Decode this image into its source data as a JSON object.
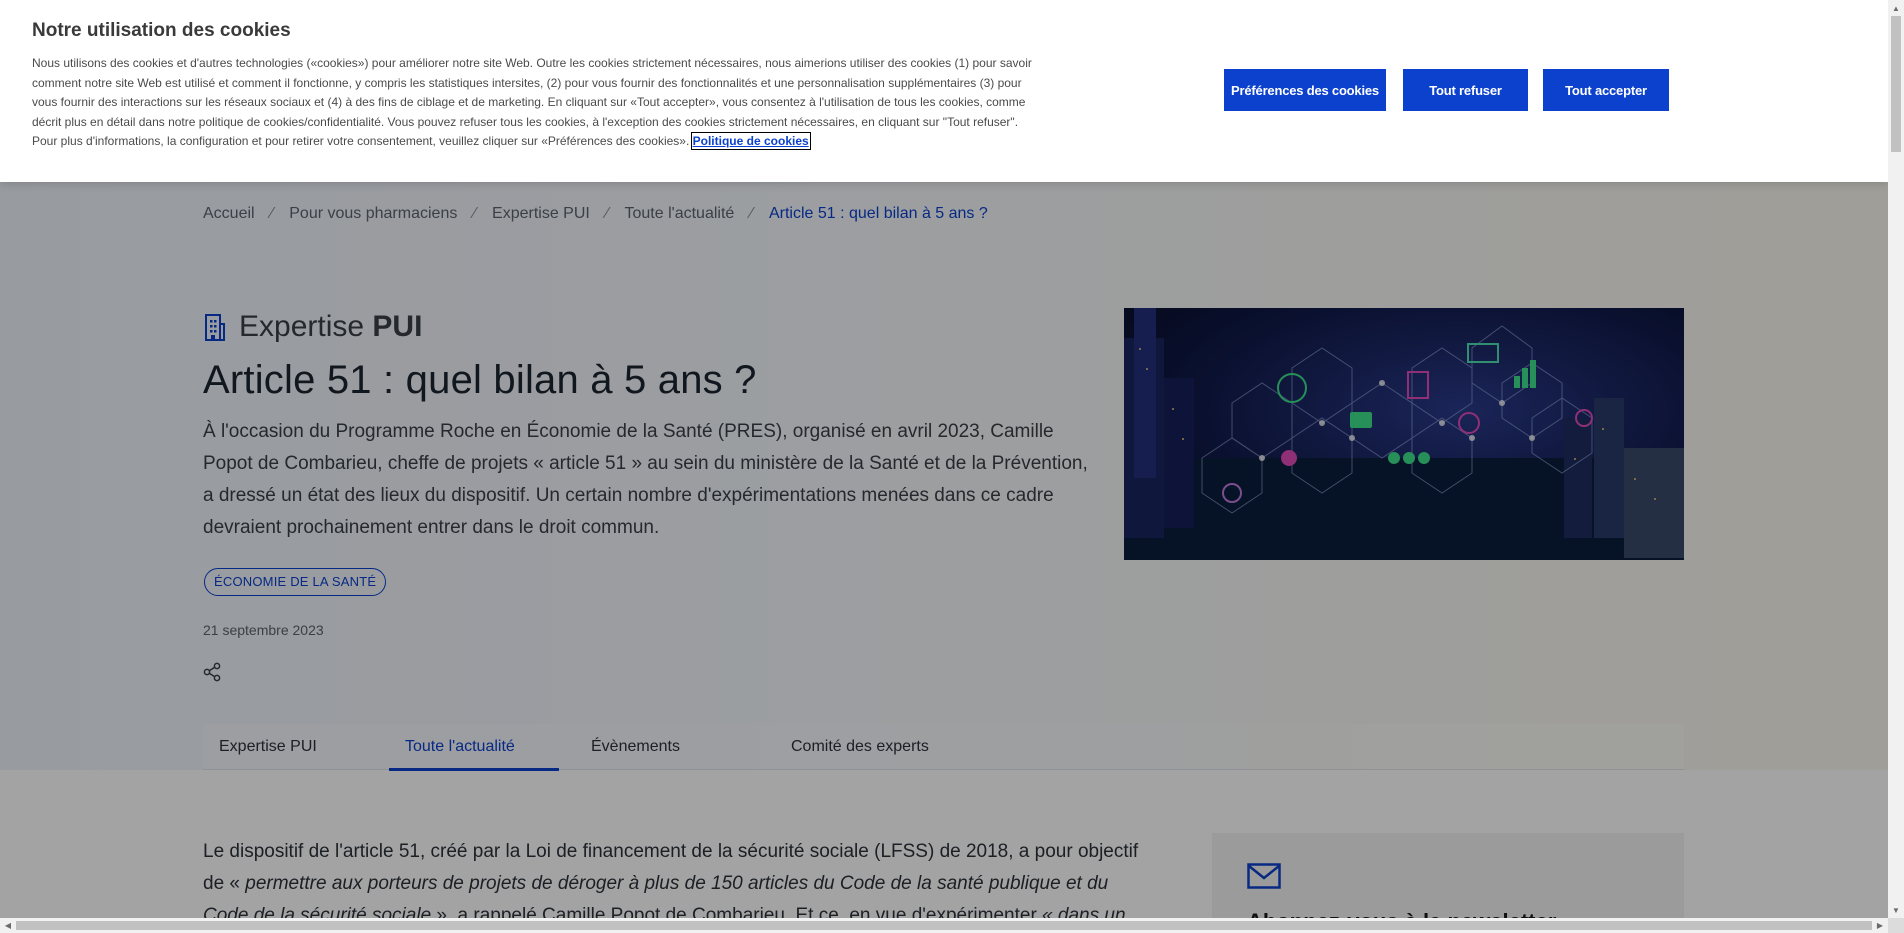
{
  "cookie_banner": {
    "title": "Notre utilisation des cookies",
    "text": "Nous utilisons des cookies et d'autres technologies («cookies») pour améliorer notre site Web. Outre les cookies strictement nécessaires, nous aimerions utiliser des cookies (1) pour savoir comment notre site Web est utilisé et comment il fonctionne, y compris les statistiques intersites, (2) pour vous fournir des fonctionnalités et une personnalisation supplémentaires (3) pour vous fournir des interactions sur les réseaux sociaux et (4) à des fins de ciblage et de marketing. En cliquant sur «Tout accepter», vous consentez à l'utilisation de tous les cookies, comme décrit plus en détail dans notre politique de cookies/confidentialité. Vous pouvez refuser tous les cookies, à l'exception des cookies strictement nécessaires, en cliquant sur \"Tout refuser\". Pour plus d'informations, la configuration et pour retirer votre consentement, veuillez cliquer sur «Préférences des cookies».",
    "policy_link": "Politique de cookies",
    "btn_preferences": "Préférences des cookies",
    "btn_refuse": "Tout refuser",
    "btn_accept": "Tout accepter"
  },
  "breadcrumb": {
    "items": [
      "Accueil",
      "Pour vous pharmaciens",
      "Expertise PUI",
      "Toute l'actualité"
    ],
    "separator": "⁄",
    "current": "Article 51 : quel bilan à 5 ans ?"
  },
  "section": {
    "prefix": "Expertise",
    "name": "PUI"
  },
  "article": {
    "title": "Article 51 : quel bilan à 5 ans ?",
    "lead": "À l'occasion du Programme Roche en Économie de la Santé (PRES), organisé en avril 2023, Camille Popot de Combarieu, cheffe de projets « article 51 » au sein du ministère de la Santé et de la Prévention, a dressé un état des lieux du dispositif. Un certain nombre d'expérimentations menées dans ce cadre devraient prochainement entrer dans le droit commun.",
    "topic": "ÉCONOMIE DE LA SANTÉ",
    "date": "21 septembre 2023"
  },
  "tabs": [
    {
      "label": "Expertise PUI",
      "active": false
    },
    {
      "label": "Toute l'actualité",
      "active": true
    },
    {
      "label": "Évènements",
      "active": false
    },
    {
      "label": "Comité des experts",
      "active": false
    }
  ],
  "body": {
    "p1_start": "Le dispositif de l'article 51, créé par la Loi de financement de la sécurité sociale (LFSS) de 2018, a pour objectif de « ",
    "p1_quote": "permettre aux porteurs de projets de déroger à plus de 150 articles du Code de la santé publique et du Code de la sécurité sociale",
    "p1_mid": " », a rappelé Camille Popot de Combarieu. Et ce, en vue d'expérimenter ",
    "p1_quote2": "« dans un temps défini sur un"
  },
  "newsletter": {
    "title": "Abonnez-vous à la newsletter"
  },
  "colors": {
    "accent": "#0b41cd",
    "text": "#1a1a1a"
  },
  "icons": {
    "section": "building-icon",
    "share": "share-icon",
    "newsletter": "mail-icon"
  }
}
